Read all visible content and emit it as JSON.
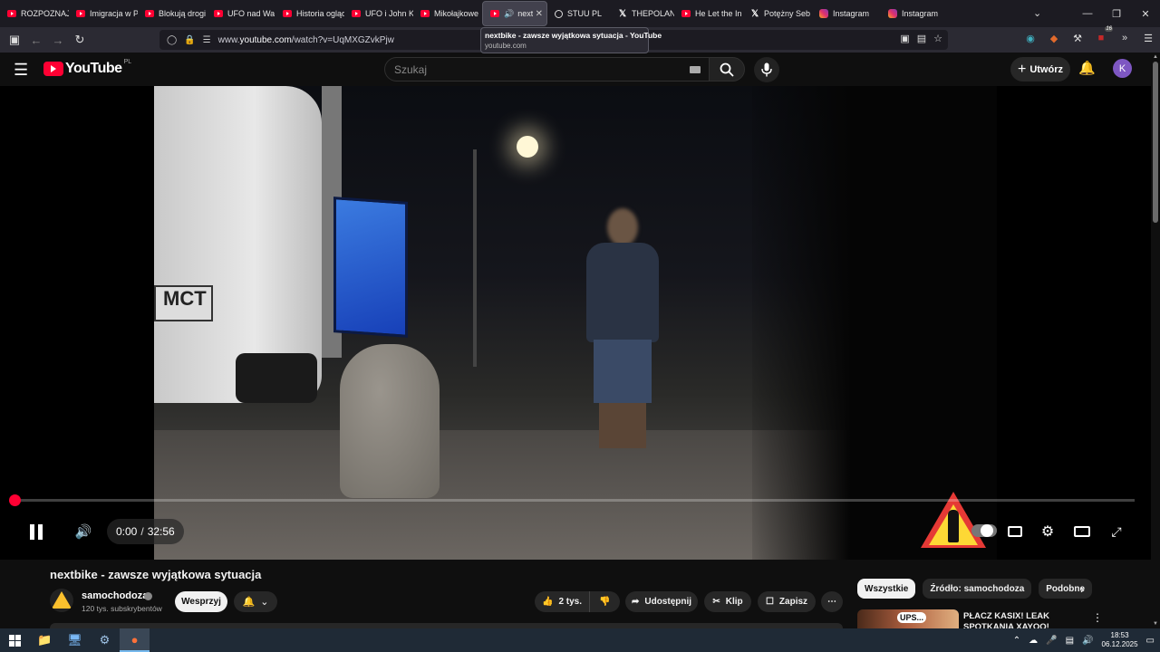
{
  "browser": {
    "tabs": [
      {
        "label": "ROZPOZNAJ",
        "icon": "youtube-icon"
      },
      {
        "label": "Imigracja w P",
        "icon": "youtube-icon"
      },
      {
        "label": "Blokują drogi",
        "icon": "youtube-icon"
      },
      {
        "label": "UFO nad Wa",
        "icon": "youtube-icon"
      },
      {
        "label": "Historia ogląd",
        "icon": "youtube-icon"
      },
      {
        "label": "UFO i John K",
        "icon": "youtube-icon"
      },
      {
        "label": "Mikołajkowe",
        "icon": "youtube-icon"
      },
      {
        "label": "next",
        "icon": "youtube-icon",
        "active": true,
        "audio": true
      },
      {
        "label": "STUU PL",
        "icon": "web-icon"
      },
      {
        "label": "THEPOLAND",
        "icon": "x-icon"
      },
      {
        "label": "He Let the In",
        "icon": "youtube-icon"
      },
      {
        "label": "Potężny Seb",
        "icon": "x-icon"
      },
      {
        "label": "Instagram",
        "icon": "instagram-icon"
      },
      {
        "label": "Instagram",
        "icon": "instagram-icon"
      }
    ],
    "tooltip": {
      "title": "nextbike - zawsze wyjątkowa sytuacja - YouTube",
      "host": "youtube.com"
    },
    "url_prefix": "www.",
    "url_host": "youtube.com",
    "url_path": "/watch?v=UqMXGZvkPjw",
    "ext_badge": "16"
  },
  "youtube": {
    "logo_text": "YouTube",
    "country_code": "PL",
    "search_placeholder": "Szukaj",
    "create_label": "Utwórz",
    "avatar_letter": "K"
  },
  "player": {
    "current_time": "0:00",
    "separator": "/",
    "duration": "32:56",
    "progress_fraction": 0.0,
    "accent_color": "#ff0033"
  },
  "video": {
    "title": "nextbike - zawsze wyjątkowa sytuacja",
    "channel_name": "samochodoza",
    "subscribers": "120 tys. subskrybentów",
    "support_label": "Wesprzyj",
    "likes": "2 tys.",
    "share_label": "Udostępnij",
    "clip_label": "Klip",
    "save_label": "Zapisz"
  },
  "sidebar": {
    "chips": [
      "Wszystkie",
      "Źródło: samochodoza",
      "Podobne"
    ],
    "rec_title": "PŁACZ KASIX! LEAK SPOTKANIA XAYOO!",
    "rec_thumb_text": "UPS..."
  },
  "taskbar": {
    "time": "18:53",
    "date": "06.12.2025"
  }
}
